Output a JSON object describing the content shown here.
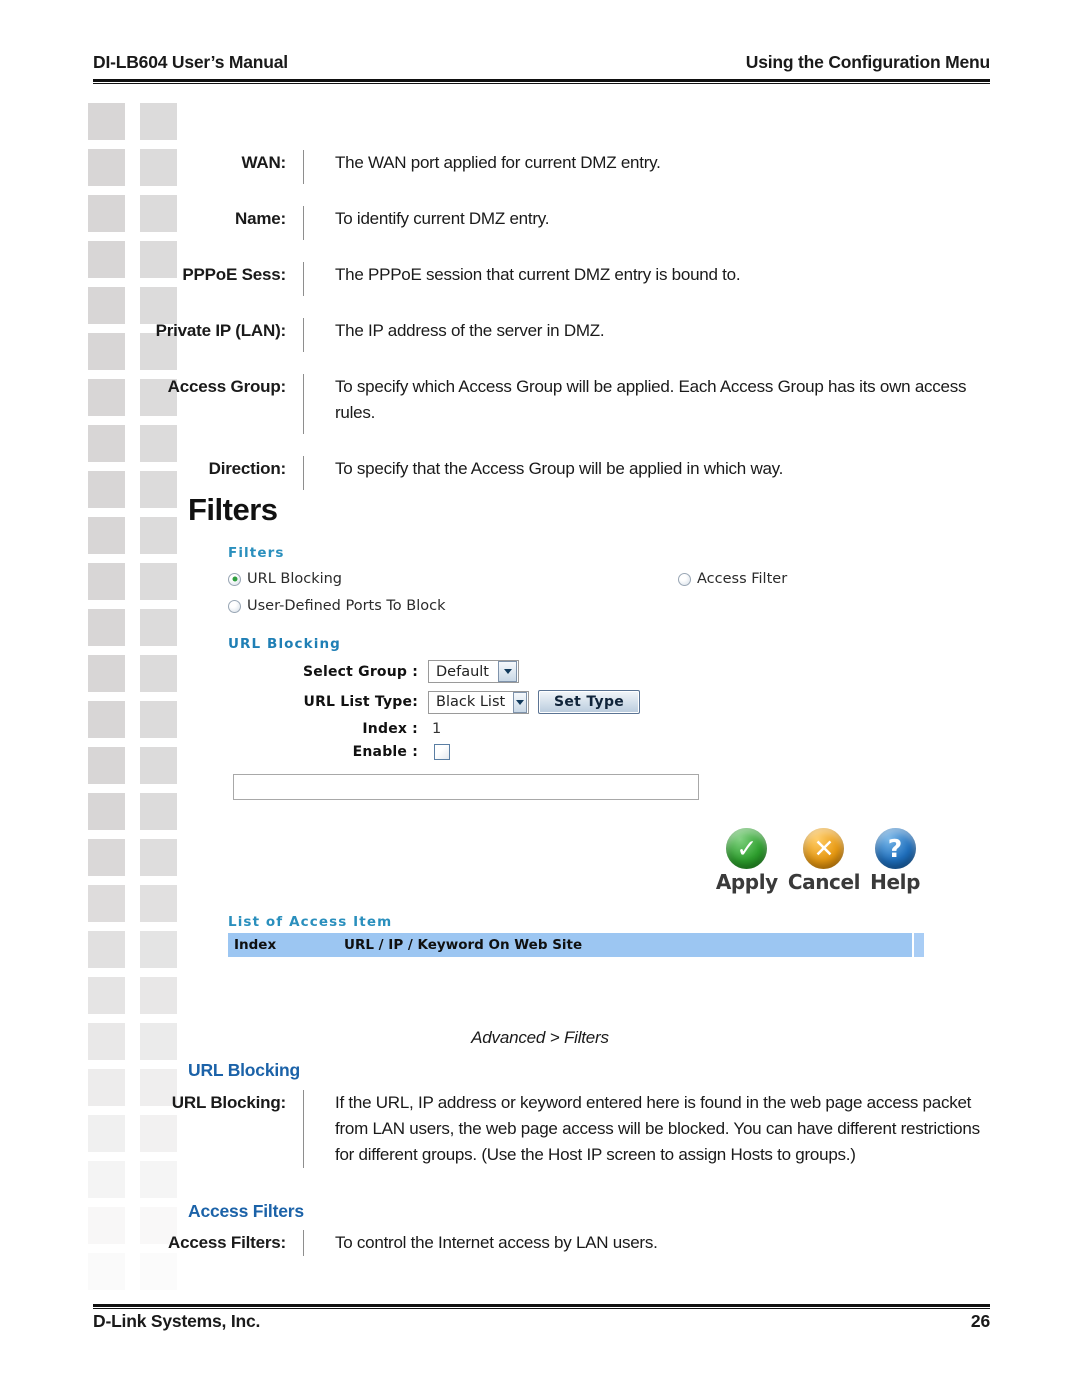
{
  "header": {
    "left": "DI-LB604 User’s Manual",
    "right": "Using the Configuration Menu"
  },
  "top_definitions": [
    {
      "term": "WAN:",
      "desc": "The WAN port applied for current DMZ entry."
    },
    {
      "term": "Name:",
      "desc": "To identify current DMZ entry."
    },
    {
      "term": "PPPoE Sess:",
      "desc": "The PPPoE session that current DMZ entry is bound to."
    },
    {
      "term": "Private IP (LAN):",
      "desc": "The IP address of the server in DMZ."
    },
    {
      "term": "Access Group:",
      "desc": "To specify which Access Group will be applied. Each Access Group has its own access rules."
    },
    {
      "term": "Direction:",
      "desc": "To specify that the Access Group will be applied in which way."
    }
  ],
  "section_title": "Filters",
  "ui_screenshot": {
    "filters_legend": "Filters",
    "radios": [
      {
        "label": "URL Blocking",
        "selected": true
      },
      {
        "label": "Access Filter",
        "selected": false
      },
      {
        "label": "User-Defined Ports To Block",
        "selected": false
      }
    ],
    "url_blocking_legend": "URL Blocking",
    "fields": {
      "select_group_label": "Select Group :",
      "select_group_value": "Default",
      "url_list_type_label": "URL List Type:",
      "url_list_type_value": "Black List",
      "set_type_button": "Set Type",
      "index_label": "Index :",
      "index_value": "1",
      "enable_label": "Enable :",
      "enable_checked": false,
      "keyword_input_value": ""
    },
    "actions": [
      {
        "label": "Apply",
        "glyph": "✓",
        "color": "#2ea02e"
      },
      {
        "label": "Cancel",
        "glyph": "✕",
        "color": "#e89a13"
      },
      {
        "label": "Help",
        "glyph": "?",
        "color": "#1f6fbd"
      }
    ],
    "table": {
      "title": "List of Access Item",
      "columns": [
        "Index",
        "URL / IP / Keyword On Web Site"
      ],
      "rows": []
    }
  },
  "caption": "Advanced > Filters",
  "url_blocking_section": {
    "heading": "URL Blocking",
    "term": "URL Blocking:",
    "desc": "If the URL, IP address or keyword entered here is found in the web page access packet from LAN users, the web page access will be blocked. You can have different restrictions for different groups. (Use the Host IP screen to assign Hosts to groups.)"
  },
  "access_filters_section": {
    "heading": "Access Filters",
    "term": "Access Filters:",
    "desc": "To control the Internet access by LAN users."
  },
  "footer": {
    "left": "D-Link Systems, Inc.",
    "page": "26"
  },
  "colors": {
    "accent_blue": "#1b62a8",
    "ui_legend_blue": "#2a8fbd",
    "table_header_blue": "#9cc6f2"
  }
}
